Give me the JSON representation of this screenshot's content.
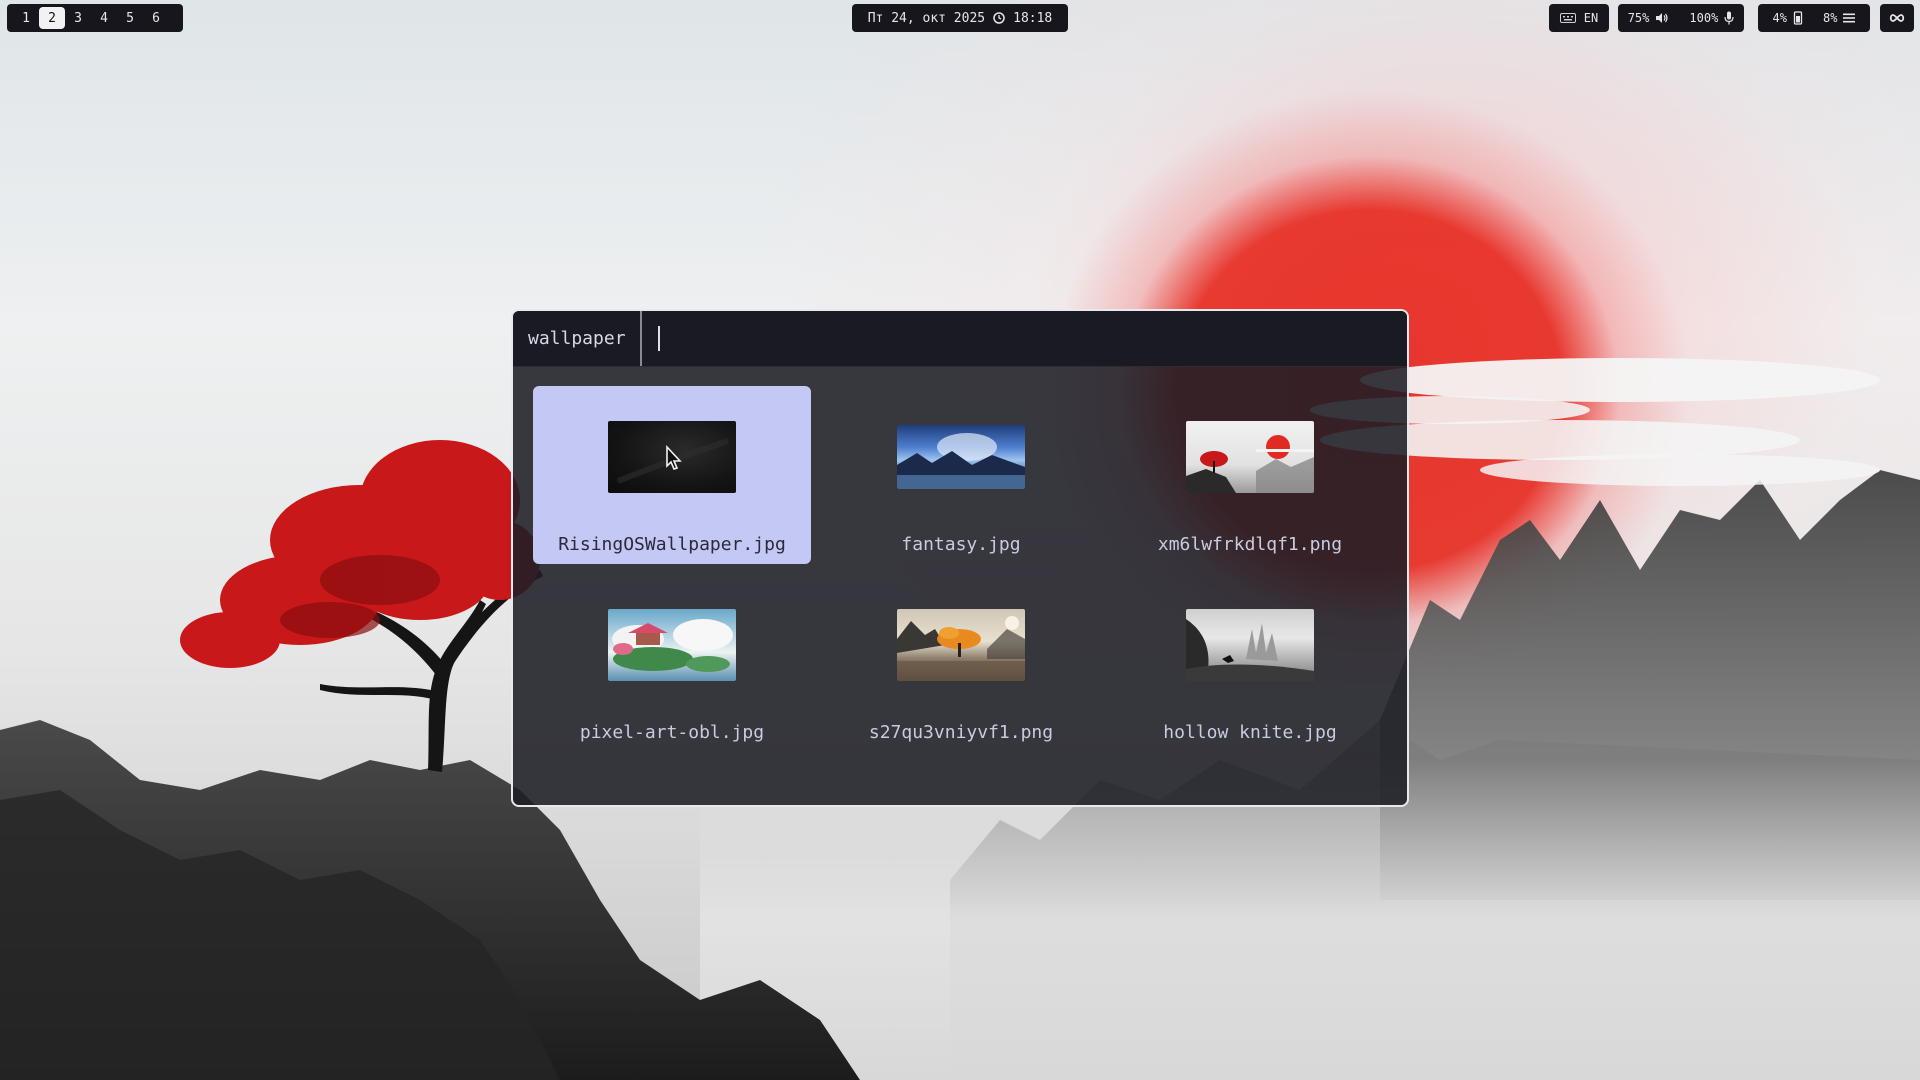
{
  "topbar": {
    "workspaces": [
      {
        "label": "1",
        "active": false
      },
      {
        "label": "2",
        "active": true
      },
      {
        "label": "3",
        "active": false
      },
      {
        "label": "4",
        "active": false
      },
      {
        "label": "5",
        "active": false
      },
      {
        "label": "6",
        "active": false
      }
    ],
    "date": "Пт 24, окт 2025",
    "time": "18:18",
    "keyboard_layout": "EN",
    "volume": "75%",
    "mic": "100%",
    "cpu": "4%",
    "mem": "8%"
  },
  "launcher": {
    "mode_label": "wallpaper",
    "search_value": "",
    "items": [
      {
        "label": "RisingOSWallpaper.jpg",
        "selected": true
      },
      {
        "label": "fantasy.jpg",
        "selected": false
      },
      {
        "label": "xm6lwfrkdlqf1.png",
        "selected": false
      },
      {
        "label": "pixel-art-obl.jpg",
        "selected": false
      },
      {
        "label": "s27qu3vniyvf1.png",
        "selected": false
      },
      {
        "label": "hollow knite.jpg",
        "selected": false
      }
    ]
  },
  "colors": {
    "bar_bg": "#16161c",
    "launcher_bg": "#1e1e26",
    "selection": "#c3c8f4",
    "sun": "#e6281e",
    "tree": "#d11a1a"
  }
}
